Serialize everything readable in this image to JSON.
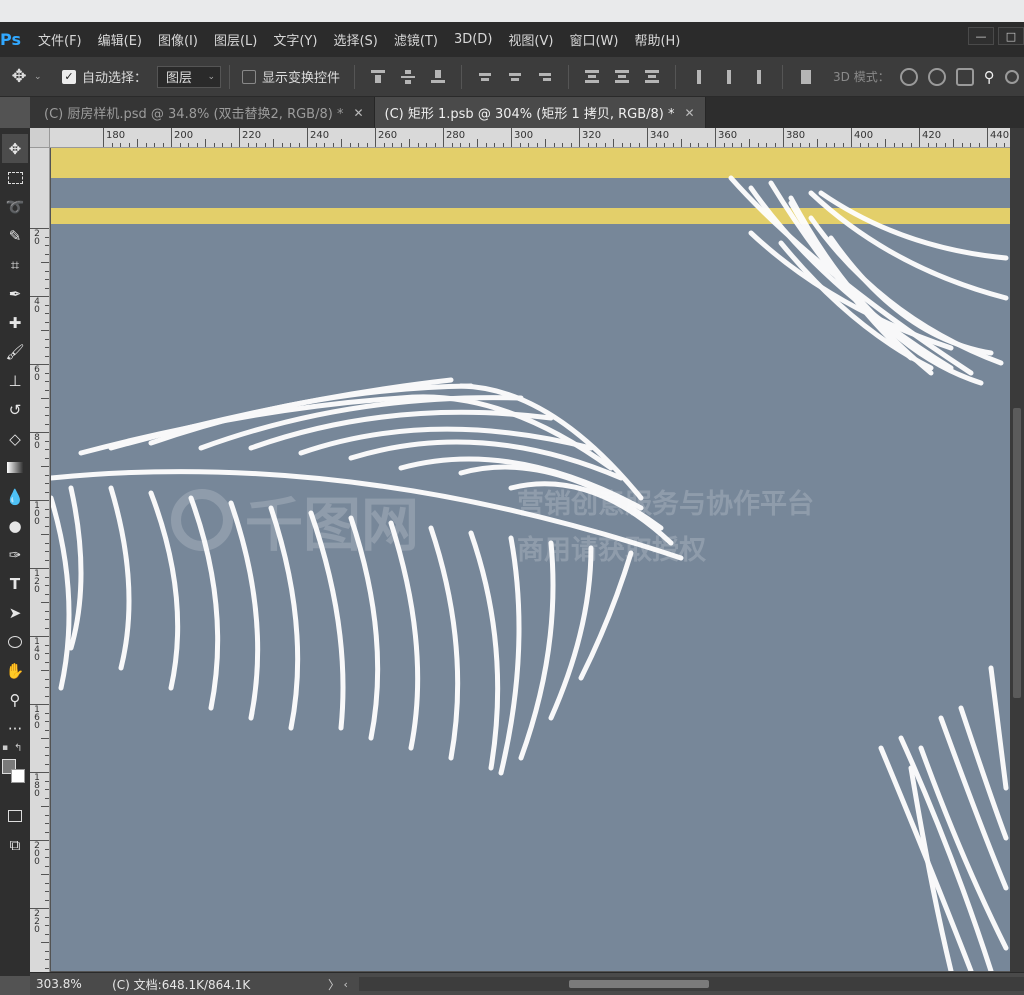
{
  "app": {
    "logo": "Ps"
  },
  "menu": [
    "文件(F)",
    "编辑(E)",
    "图像(I)",
    "图层(L)",
    "文字(Y)",
    "选择(S)",
    "滤镜(T)",
    "3D(D)",
    "视图(V)",
    "窗口(W)",
    "帮助(H)"
  ],
  "window_buttons": [
    "—",
    "□"
  ],
  "options": {
    "auto_select_label": "自动选择：",
    "auto_select_checked": true,
    "layer_select_value": "图层",
    "show_transform_label": "显示变换控件",
    "show_transform_checked": false,
    "mode_3d_label": "3D 模式："
  },
  "tabs": [
    {
      "label": "(C) 厨房样机.psd @ 34.8% (双击替换2, RGB/8) *",
      "active": false
    },
    {
      "label": "(C) 矩形 1.psb @ 304% (矩形 1 拷贝, RGB/8) *",
      "active": true
    }
  ],
  "ruler": {
    "h_labels": [
      "180",
      "200",
      "220",
      "240",
      "260",
      "280",
      "300",
      "320",
      "340",
      "360",
      "380",
      "400",
      "420",
      "440"
    ],
    "v_labels": [
      "2\n0",
      "4\n0",
      "6\n0",
      "8\n0",
      "1\n0\n0",
      "1\n2\n0",
      "1\n4\n0",
      "1\n6\n0",
      "1\n8\n0",
      "2\n0\n0",
      "2\n2\n0"
    ]
  },
  "watermark": {
    "logo_text": "千图网",
    "line1": "营销创意服务与协作平台",
    "line2": "商用请获取授权"
  },
  "status": {
    "zoom": "303.8%",
    "doc_info": "(C) 文档:648.1K/864.1K",
    "arrow": "〉"
  },
  "colors": {
    "canvas_bg": "#778799",
    "stripe": "#e3cf6a",
    "feather": "#ffffff"
  }
}
